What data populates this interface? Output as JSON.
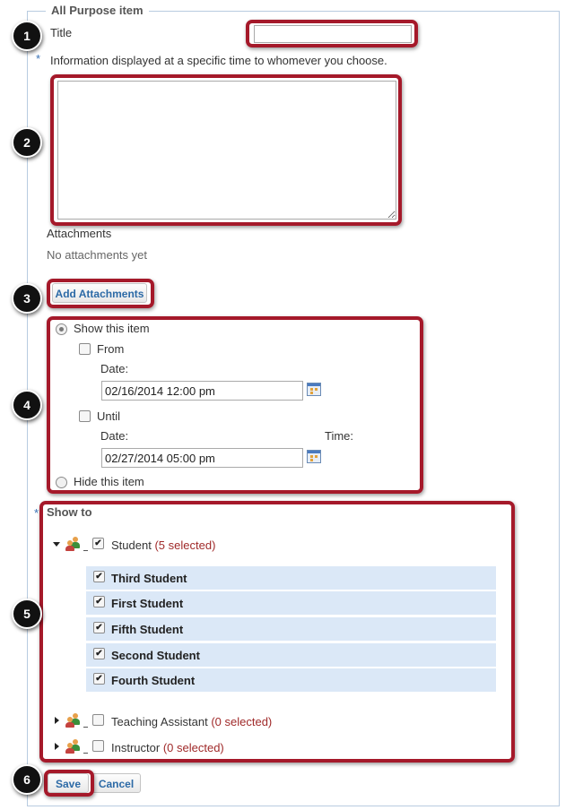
{
  "legend": "All Purpose item",
  "title_label": "Title",
  "title_value": "",
  "required_mark": "*",
  "info_label": "Information displayed at a specific time to whomever you choose.",
  "info_value": "",
  "attachments": {
    "heading": "Attachments",
    "empty_text": "No attachments yet",
    "add_button": "Add Attachments"
  },
  "visibility": {
    "show_label": "Show this item",
    "show_selected": true,
    "from_label": "From",
    "from_checked": false,
    "from_date_label": "Date:",
    "from_date_value": "02/16/2014 12:00 pm",
    "until_label": "Until",
    "until_checked": false,
    "until_date_label": "Date:",
    "until_time_label": "Time:",
    "until_date_value": "02/27/2014 05:00 pm",
    "hide_label": "Hide this item"
  },
  "show_to": {
    "heading": "Show to",
    "groups": [
      {
        "name": "Student",
        "paren_open": "(",
        "selected_text": "5 selected",
        "paren_close": ")",
        "expanded": true,
        "checked": true,
        "members": [
          "Third Student",
          "First Student",
          "Fifth Student",
          "Second Student",
          "Fourth Student"
        ]
      },
      {
        "name": "Teaching Assistant",
        "paren_open": "(",
        "selected_text": "0 selected",
        "paren_close": ")",
        "expanded": false,
        "checked": false
      },
      {
        "name": "Instructor",
        "paren_open": "(",
        "selected_text": "0 selected",
        "paren_close": ")",
        "expanded": false,
        "checked": false
      }
    ]
  },
  "buttons": {
    "save": "Save",
    "cancel": "Cancel"
  },
  "badges": [
    "1",
    "2",
    "3",
    "4",
    "5",
    "6"
  ],
  "colors": {
    "highlight": "#a5192a",
    "link": "#2c6aa6",
    "selected_count": "#a02a2a",
    "row_bg": "#dbe8f7"
  },
  "icons": {
    "calendar": "calendar-icon",
    "group": "people-group-icon",
    "expand": "triangle-icon"
  }
}
